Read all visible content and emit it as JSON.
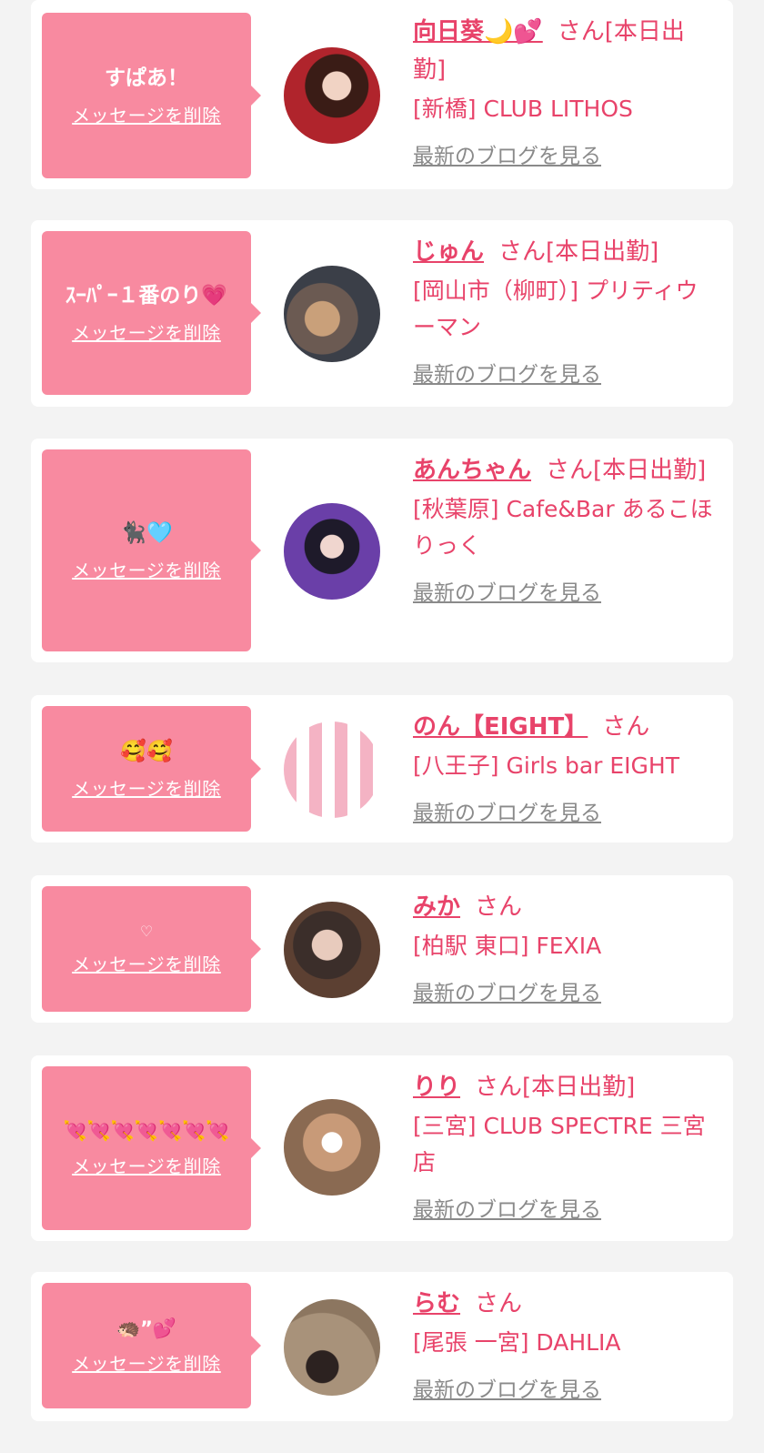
{
  "delete_label": "メッセージを削除",
  "blog_label": "最新のブログを見る",
  "honorific": "さん",
  "items": [
    {
      "message": "すぱあ！",
      "name": "向日葵🌙💕",
      "status": "[本日出勤]",
      "shop": "[新橋] CLUB LITHOS"
    },
    {
      "message": "ｽｰﾊﾟｰ１番のり💗",
      "name": "じゅん",
      "status": "[本日出勤]",
      "shop": "[岡山市（柳町）] プリティウーマン"
    },
    {
      "message": "🐈‍⬛🩵",
      "name": "あんちゃん",
      "status": "[本日出勤]",
      "shop": "[秋葉原] Cafe&Bar あるこほりっく"
    },
    {
      "message": "🥰🥰",
      "name": "のん【EIGHT】",
      "status": "",
      "shop": "[八王子] Girls bar EIGHT"
    },
    {
      "message": "♡",
      "name": "みか",
      "status": "",
      "shop": "[柏駅 東口] FEXIA"
    },
    {
      "message": "💘💘💘💘💘💘💘",
      "name": "りり",
      "status": "[本日出勤]",
      "shop": "[三宮] CLUB SPECTRE 三宮店"
    },
    {
      "message": "🦔”💕",
      "name": "らむ",
      "status": "",
      "shop": "[尾張 一宮] DAHLIA"
    }
  ]
}
